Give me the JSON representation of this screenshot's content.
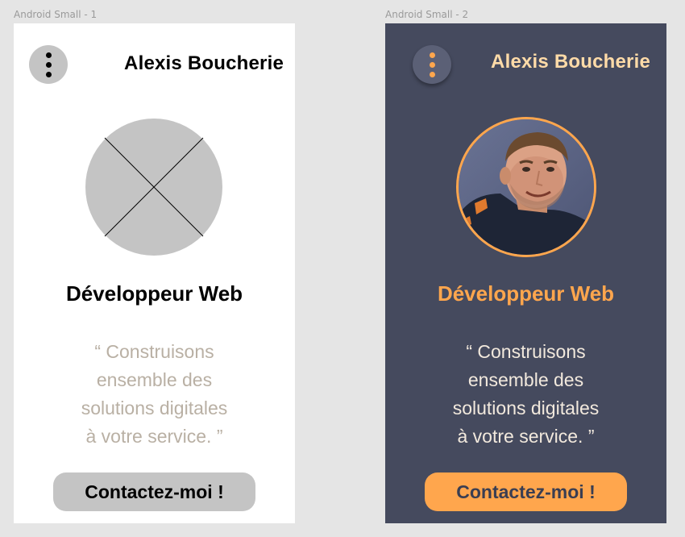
{
  "frames": [
    {
      "label": "Android Small - 1",
      "name": "Alexis Boucherie",
      "role": "Développeur Web",
      "quote_lines": [
        "“ Construisons",
        "ensemble des",
        "solutions digitales",
        "à votre service. ”"
      ],
      "contact_label": "Contactez-moi !",
      "menu_icon": "kebab-menu-icon",
      "avatar_icon": "image-placeholder-icon",
      "background": "#ffffff"
    },
    {
      "label": "Android Small - 2",
      "name": "Alexis Boucherie",
      "role": "Développeur Web",
      "quote_lines": [
        "“ Construisons",
        "ensemble des",
        "solutions digitales",
        "à votre service. ”"
      ],
      "contact_label": "Contactez-moi !",
      "menu_icon": "kebab-menu-icon",
      "avatar_icon": "profile-photo",
      "background": "#454a5e",
      "accent": "#ffa64d"
    }
  ]
}
